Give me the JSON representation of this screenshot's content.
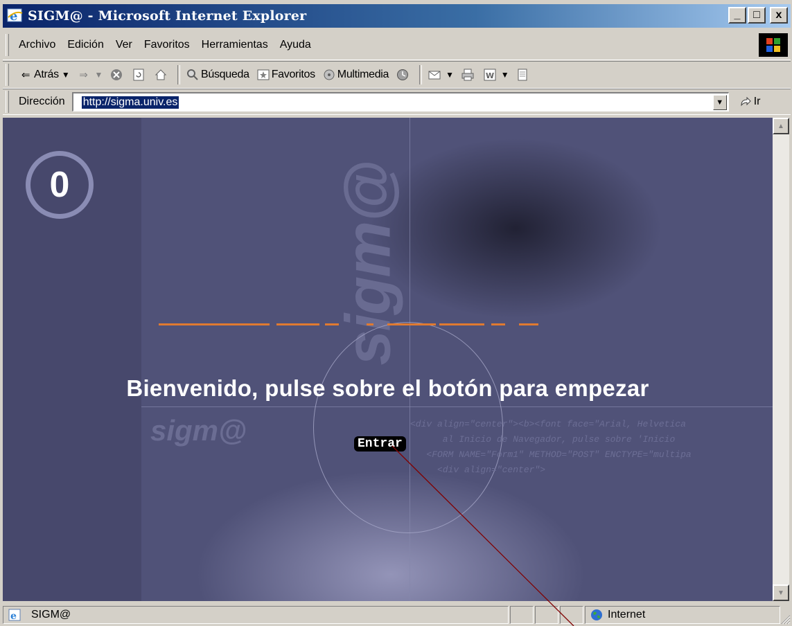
{
  "window": {
    "title": "SIGM@ - Microsoft Internet Explorer",
    "caption_buttons": [
      "_",
      "□",
      "x"
    ]
  },
  "menu": {
    "items": [
      "Archivo",
      "Edición",
      "Ver",
      "Favoritos",
      "Herramientas",
      "Ayuda"
    ]
  },
  "toolbar": {
    "back_label": "Atrás",
    "search_label": "Búsqueda",
    "favorites_label": "Favoritos",
    "media_label": "Multimedia"
  },
  "address": {
    "label": "Dirección",
    "url": "http://sigma.univ.es",
    "go_label": "Ir"
  },
  "page": {
    "logo_text": "0",
    "vertical_watermark": "sigm@",
    "welcome": "Bienvenido, pulse sobre el botón para empezar",
    "sigma_watermark": "sigm@",
    "code_lines": [
      "<div align=\"center\"><b><font face=\"Arial, Helvetica",
      "      al Inicio de Navegador, pulse sobre 'Inicio",
      "   <FORM NAME=\"Form1\" METHOD=\"POST\" ENCTYPE=\"multipa",
      "     <div align=\"center\">"
    ],
    "enter_button": "Entrar"
  },
  "status": {
    "text": "SIGM@",
    "zone": "Internet"
  },
  "colors": {
    "title_gradient_start": "#0a246a",
    "content_bg": "#4b4c72",
    "annotation_line": "#800000",
    "orange_accent": "#e07a30"
  }
}
